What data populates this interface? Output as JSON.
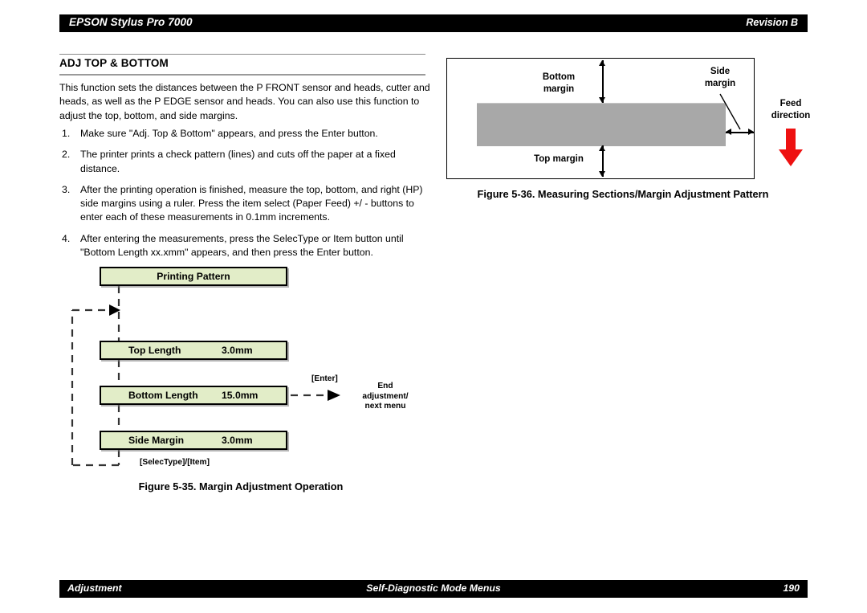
{
  "header": {
    "product_title": "EPSON Stylus Pro 7000",
    "revision": "Revision B"
  },
  "section": {
    "title": "ADJ TOP & BOTTOM",
    "intro": "This function sets the distances between the P FRONT sensor and heads, cutter and heads, as well as the P EDGE sensor and heads. You can also use this function to adjust the top, bottom, and side margins.",
    "steps": [
      {
        "num": "1.",
        "text": "Make sure \"Adj. Top & Bottom\" appears, and press the Enter button."
      },
      {
        "num": "2.",
        "text": "The printer prints a check pattern (lines) and cuts off the paper at a fixed distance."
      },
      {
        "num": "3.",
        "text": "After the printing operation is finished, measure the top, bottom, and right (HP) side margins using a ruler. Press the item select (Paper Feed) +/ - buttons to enter each of these measurements in 0.1mm increments."
      },
      {
        "num": "4.",
        "text": "After entering the measurements, press the SelecType or Item button until \"Bottom Length xx.xmm\" appears, and then press the Enter button."
      }
    ]
  },
  "figure_36": {
    "caption": "Figure 5-36.  Measuring Sections/Margin Adjustment Pattern",
    "labels": {
      "bottom_margin": "Bottom\nmargin",
      "bottom_margin_line1": "Bottom",
      "bottom_margin_line2": "margin",
      "top_margin": "Top margin",
      "side_margin_line1": "Side",
      "side_margin_line2": "margin",
      "feed_line1": "Feed",
      "feed_line2": "direction"
    },
    "colors": {
      "pattern_fill": "#a8a8a8",
      "feed_arrow": "#ee1111",
      "border": "#000000"
    }
  },
  "figure_35": {
    "caption": "Figure 5-35.  Margin Adjustment Operation",
    "boxes": [
      {
        "label": "Printing Pattern",
        "value": ""
      },
      {
        "label": "Top Length",
        "value": "3.0mm"
      },
      {
        "label": "Bottom Length",
        "value": "15.0mm"
      },
      {
        "label": "Side Margin",
        "value": "3.0mm"
      }
    ],
    "annotations": {
      "enter_key": "[Enter]",
      "end_line1": "End",
      "end_line2": "adjustment/",
      "end_line3": "next menu",
      "selectype_item": "[SelecType]/[Item]"
    },
    "colors": {
      "box_fill": "#e2edc8",
      "box_border": "#000000"
    }
  },
  "footer": {
    "left": "Adjustment",
    "center": "Self-Diagnostic Mode Menus",
    "page": "190"
  }
}
